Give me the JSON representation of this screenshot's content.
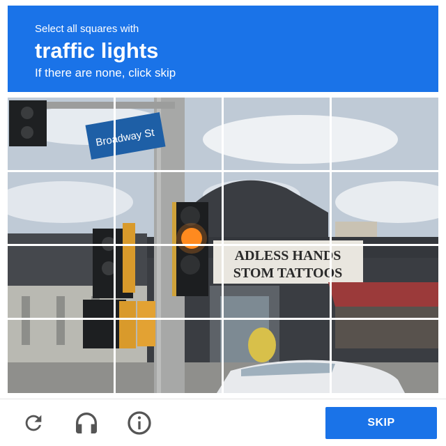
{
  "header": {
    "instruction": "Select all squares with",
    "target": "traffic lights",
    "hint": "If there are none, click skip"
  },
  "image": {
    "street_sign": "Broadway St",
    "shop_sign_line1": "ADLESS HANDS",
    "shop_sign_line2": "STOM TATTOOS",
    "grid_rows": 4,
    "grid_cols": 4
  },
  "footer": {
    "reload_icon": "reload-icon",
    "audio_icon": "headphones-icon",
    "info_icon": "info-icon",
    "skip_label": "SKIP"
  },
  "colors": {
    "accent": "#1a73e8",
    "traffic_light_lit": "#ff8a1f"
  }
}
